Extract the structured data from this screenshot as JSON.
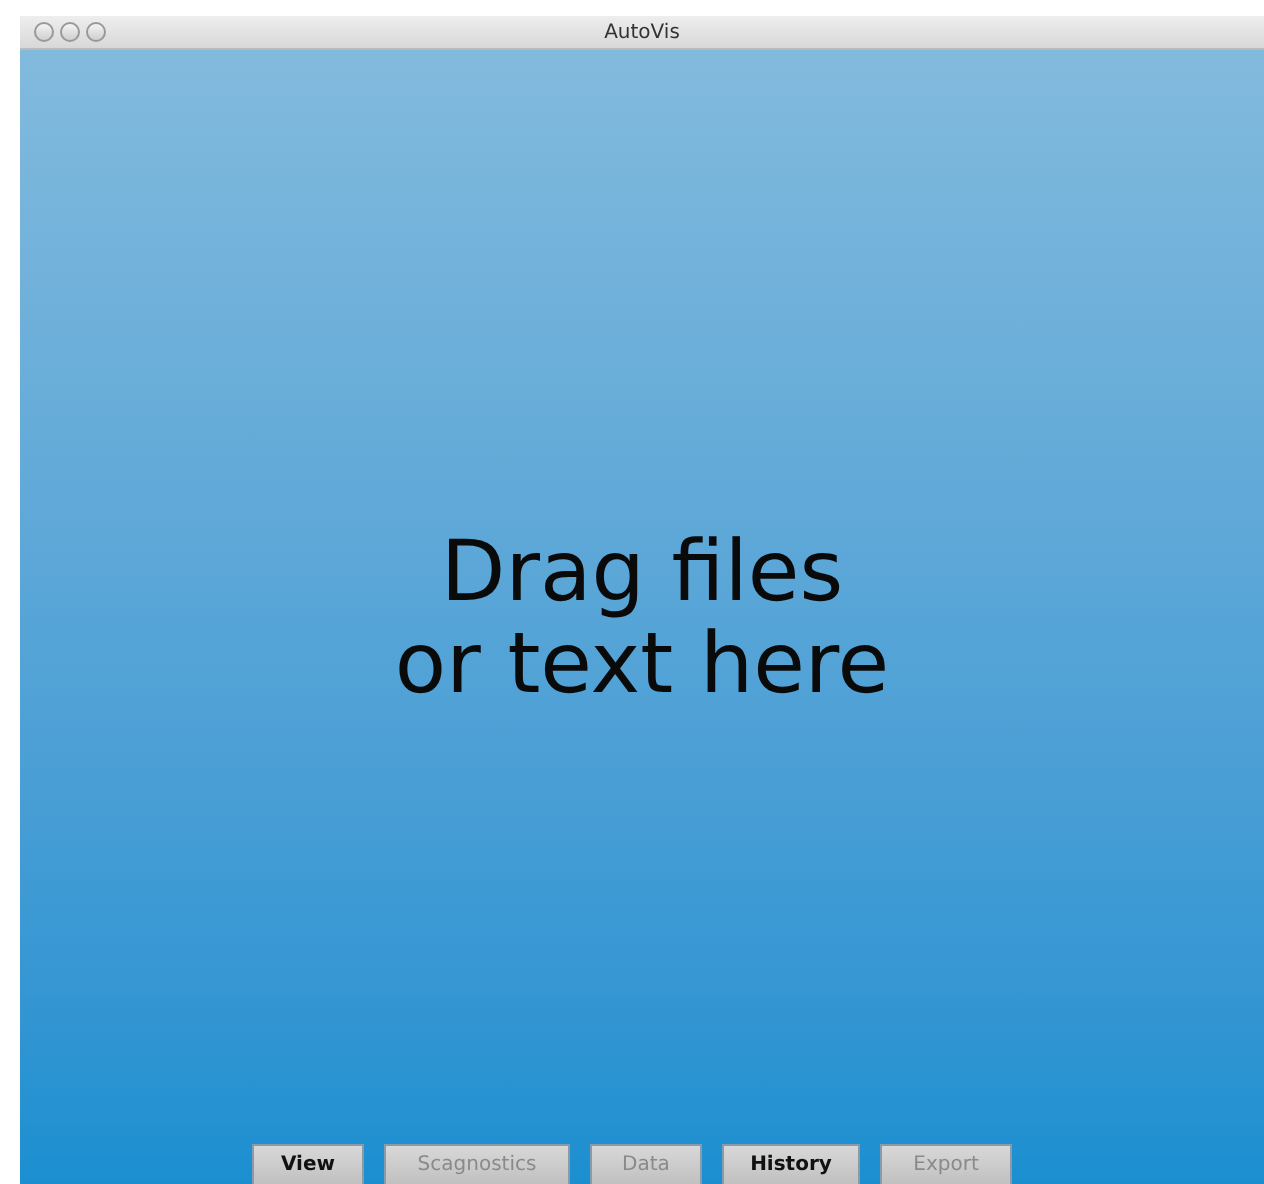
{
  "window": {
    "title": "AutoVis"
  },
  "drop_zone": {
    "lines": [
      "Drag files",
      "or text here"
    ]
  },
  "buttons": [
    {
      "label": "View",
      "disabled": false
    },
    {
      "label": "Scagnostics",
      "disabled": true
    },
    {
      "label": "Data",
      "disabled": true
    },
    {
      "label": "History",
      "disabled": false
    },
    {
      "label": "Export",
      "disabled": true
    }
  ]
}
